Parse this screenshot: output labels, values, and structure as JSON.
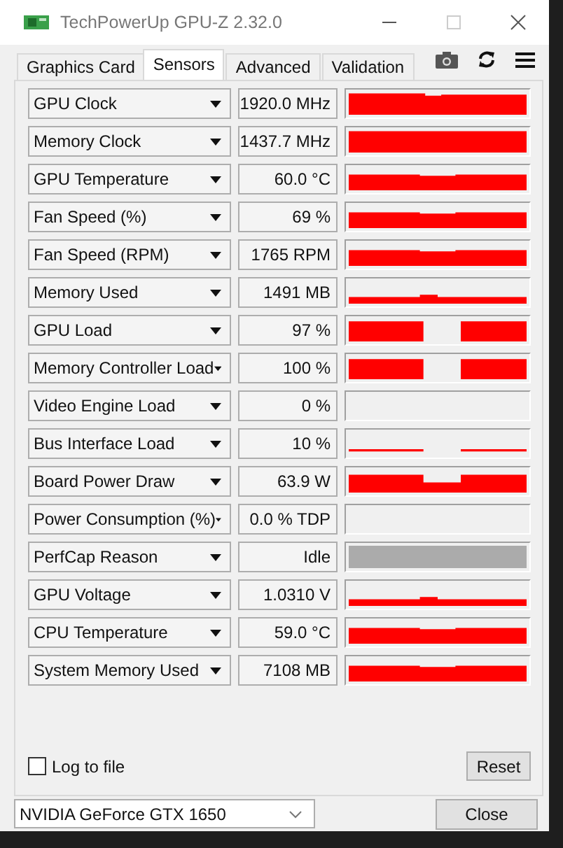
{
  "window": {
    "title": "TechPowerUp GPU-Z 2.32.0"
  },
  "tabs": [
    {
      "label": "Graphics Card",
      "selected": false
    },
    {
      "label": "Sensors",
      "selected": true
    },
    {
      "label": "Advanced",
      "selected": false
    },
    {
      "label": "Validation",
      "selected": false
    }
  ],
  "sensors": [
    {
      "name": "GPU Clock",
      "value": "1920.0 MHz",
      "kind": "high"
    },
    {
      "name": "Memory Clock",
      "value": "1437.7 MHz",
      "kind": "full"
    },
    {
      "name": "GPU Temperature",
      "value": "60.0 °C",
      "kind": "mid"
    },
    {
      "name": "Fan Speed (%)",
      "value": "69 %",
      "kind": "mid"
    },
    {
      "name": "Fan Speed (RPM)",
      "value": "1765 RPM",
      "kind": "mid"
    },
    {
      "name": "Memory Used",
      "value": "1491 MB",
      "kind": "low"
    },
    {
      "name": "GPU Load",
      "value": "97 %",
      "kind": "gap"
    },
    {
      "name": "Memory Controller Load",
      "value": "100 %",
      "kind": "gap"
    },
    {
      "name": "Video Engine Load",
      "value": "0 %",
      "kind": "empty"
    },
    {
      "name": "Bus Interface Load",
      "value": "10 %",
      "kind": "thin"
    },
    {
      "name": "Board Power Draw",
      "value": "63.9 W",
      "kind": "sag"
    },
    {
      "name": "Power Consumption (%)",
      "value": "0.0 % TDP",
      "kind": "empty"
    },
    {
      "name": "PerfCap Reason",
      "value": "Idle",
      "kind": "idle"
    },
    {
      "name": "GPU Voltage",
      "value": "1.0310 V",
      "kind": "low"
    },
    {
      "name": "CPU Temperature",
      "value": "59.0 °C",
      "kind": "mid"
    },
    {
      "name": "System Memory Used",
      "value": "7108 MB",
      "kind": "mid"
    }
  ],
  "log_to_file": {
    "label": "Log to file",
    "checked": false
  },
  "reset_button": "Reset",
  "gpu_select": {
    "value": "NVIDIA GeForce GTX 1650"
  },
  "close_button": "Close"
}
